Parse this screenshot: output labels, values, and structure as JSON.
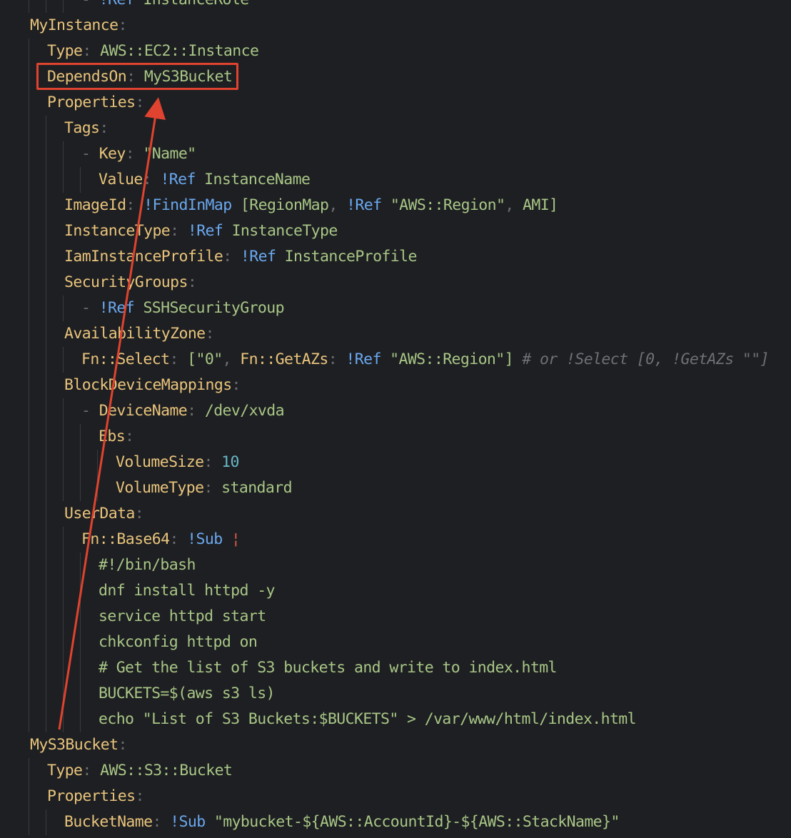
{
  "lines": [
    {
      "indent": 3,
      "parts": [
        {
          "c": "p",
          "t": "- "
        },
        {
          "c": "t",
          "t": "!Ref "
        },
        {
          "c": "s",
          "t": "InstanceRole"
        }
      ]
    },
    {
      "indent": 0,
      "parts": [
        {
          "c": "k",
          "t": "MyInstance"
        },
        {
          "c": "p",
          "t": ":"
        }
      ]
    },
    {
      "indent": 1,
      "parts": [
        {
          "c": "k",
          "t": "Type"
        },
        {
          "c": "p",
          "t": ": "
        },
        {
          "c": "s",
          "t": "AWS::EC2::Instance"
        }
      ]
    },
    {
      "indent": 1,
      "parts": [
        {
          "c": "k",
          "t": "DependsOn"
        },
        {
          "c": "p",
          "t": ": "
        },
        {
          "c": "s",
          "t": "MyS3Bucket"
        }
      ]
    },
    {
      "indent": 1,
      "parts": [
        {
          "c": "k",
          "t": "Properties"
        },
        {
          "c": "p",
          "t": ":"
        }
      ]
    },
    {
      "indent": 2,
      "parts": [
        {
          "c": "k",
          "t": "Tags"
        },
        {
          "c": "p",
          "t": ":"
        }
      ]
    },
    {
      "indent": 3,
      "parts": [
        {
          "c": "p",
          "t": "- "
        },
        {
          "c": "k",
          "t": "Key"
        },
        {
          "c": "p",
          "t": ": "
        },
        {
          "c": "s",
          "t": "\"Name\""
        }
      ]
    },
    {
      "indent": 4,
      "parts": [
        {
          "c": "k",
          "t": "Value"
        },
        {
          "c": "p",
          "t": ": "
        },
        {
          "c": "t",
          "t": "!Ref "
        },
        {
          "c": "s",
          "t": "InstanceName"
        }
      ]
    },
    {
      "indent": 2,
      "parts": [
        {
          "c": "k",
          "t": "ImageId"
        },
        {
          "c": "p",
          "t": ": "
        },
        {
          "c": "t",
          "t": "!FindInMap "
        },
        {
          "c": "s",
          "t": "[RegionMap"
        },
        {
          "c": "p",
          "t": ", "
        },
        {
          "c": "t",
          "t": "!Ref "
        },
        {
          "c": "s",
          "t": "\"AWS::Region\""
        },
        {
          "c": "p",
          "t": ", "
        },
        {
          "c": "s",
          "t": "AMI]"
        }
      ]
    },
    {
      "indent": 2,
      "parts": [
        {
          "c": "k",
          "t": "InstanceType"
        },
        {
          "c": "p",
          "t": ": "
        },
        {
          "c": "t",
          "t": "!Ref "
        },
        {
          "c": "s",
          "t": "InstanceType"
        }
      ]
    },
    {
      "indent": 2,
      "parts": [
        {
          "c": "k",
          "t": "IamInstanceProfile"
        },
        {
          "c": "p",
          "t": ": "
        },
        {
          "c": "t",
          "t": "!Ref "
        },
        {
          "c": "s",
          "t": "InstanceProfile"
        }
      ]
    },
    {
      "indent": 2,
      "parts": [
        {
          "c": "k",
          "t": "SecurityGroups"
        },
        {
          "c": "p",
          "t": ":"
        }
      ]
    },
    {
      "indent": 3,
      "parts": [
        {
          "c": "p",
          "t": "- "
        },
        {
          "c": "t",
          "t": "!Ref "
        },
        {
          "c": "s",
          "t": "SSHSecurityGroup"
        }
      ]
    },
    {
      "indent": 2,
      "parts": [
        {
          "c": "k",
          "t": "AvailabilityZone"
        },
        {
          "c": "p",
          "t": ":"
        }
      ]
    },
    {
      "indent": 3,
      "parts": [
        {
          "c": "k",
          "t": "Fn::Select"
        },
        {
          "c": "p",
          "t": ": "
        },
        {
          "c": "s",
          "t": "[\"0\""
        },
        {
          "c": "p",
          "t": ", "
        },
        {
          "c": "k",
          "t": "Fn::GetAZs"
        },
        {
          "c": "p",
          "t": ": "
        },
        {
          "c": "t",
          "t": "!Ref "
        },
        {
          "c": "s",
          "t": "\"AWS::Region\"]"
        },
        {
          "c": "c",
          "t": " # or !Select [0, !GetAZs \"\"]"
        }
      ]
    },
    {
      "indent": 2,
      "parts": [
        {
          "c": "k",
          "t": "BlockDeviceMappings"
        },
        {
          "c": "p",
          "t": ":"
        }
      ]
    },
    {
      "indent": 3,
      "parts": [
        {
          "c": "p",
          "t": "- "
        },
        {
          "c": "k",
          "t": "DeviceName"
        },
        {
          "c": "p",
          "t": ": "
        },
        {
          "c": "s",
          "t": "/dev/xvda"
        }
      ]
    },
    {
      "indent": 4,
      "parts": [
        {
          "c": "k",
          "t": "Ebs"
        },
        {
          "c": "p",
          "t": ":"
        }
      ]
    },
    {
      "indent": 5,
      "parts": [
        {
          "c": "k",
          "t": "VolumeSize"
        },
        {
          "c": "p",
          "t": ": "
        },
        {
          "c": "n",
          "t": "10"
        }
      ]
    },
    {
      "indent": 5,
      "parts": [
        {
          "c": "k",
          "t": "VolumeType"
        },
        {
          "c": "p",
          "t": ": "
        },
        {
          "c": "s",
          "t": "standard"
        }
      ]
    },
    {
      "indent": 2,
      "parts": [
        {
          "c": "k",
          "t": "UserData"
        },
        {
          "c": "p",
          "t": ":"
        }
      ]
    },
    {
      "indent": 3,
      "parts": [
        {
          "c": "k",
          "t": "Fn::Base64"
        },
        {
          "c": "p",
          "t": ": "
        },
        {
          "c": "t",
          "t": "!Sub "
        },
        {
          "c": "bar",
          "t": "¦"
        }
      ]
    },
    {
      "indent": 4,
      "parts": [
        {
          "c": "s",
          "t": "#!/bin/bash"
        }
      ]
    },
    {
      "indent": 4,
      "parts": [
        {
          "c": "s",
          "t": "dnf install httpd -y"
        }
      ]
    },
    {
      "indent": 4,
      "parts": [
        {
          "c": "s",
          "t": "service httpd start"
        }
      ]
    },
    {
      "indent": 4,
      "parts": [
        {
          "c": "s",
          "t": "chkconfig httpd on"
        }
      ]
    },
    {
      "indent": 4,
      "parts": [
        {
          "c": "s",
          "t": "# Get the list of S3 buckets and write to index.html"
        }
      ]
    },
    {
      "indent": 4,
      "parts": [
        {
          "c": "s",
          "t": "BUCKETS=$(aws s3 ls)"
        }
      ]
    },
    {
      "indent": 4,
      "parts": [
        {
          "c": "s",
          "t": "echo \"List of S3 Buckets:$BUCKETS\" > /var/www/html/index.html"
        }
      ]
    },
    {
      "indent": 0,
      "parts": [
        {
          "c": "k",
          "t": "MyS3Bucket"
        },
        {
          "c": "p",
          "t": ":"
        }
      ]
    },
    {
      "indent": 1,
      "parts": [
        {
          "c": "k",
          "t": "Type"
        },
        {
          "c": "p",
          "t": ": "
        },
        {
          "c": "s",
          "t": "AWS::S3::Bucket"
        }
      ]
    },
    {
      "indent": 1,
      "parts": [
        {
          "c": "k",
          "t": "Properties"
        },
        {
          "c": "p",
          "t": ":"
        }
      ]
    },
    {
      "indent": 2,
      "parts": [
        {
          "c": "k",
          "t": "BucketName"
        },
        {
          "c": "p",
          "t": ": "
        },
        {
          "c": "t",
          "t": "!Sub "
        },
        {
          "c": "s",
          "t": "\"mybucket-${AWS::AccountId}-${AWS::StackName}\""
        }
      ]
    }
  ],
  "annotation": {
    "highlighted_text": "DependsOn: MyS3Bucket",
    "color": "#e0432f"
  }
}
